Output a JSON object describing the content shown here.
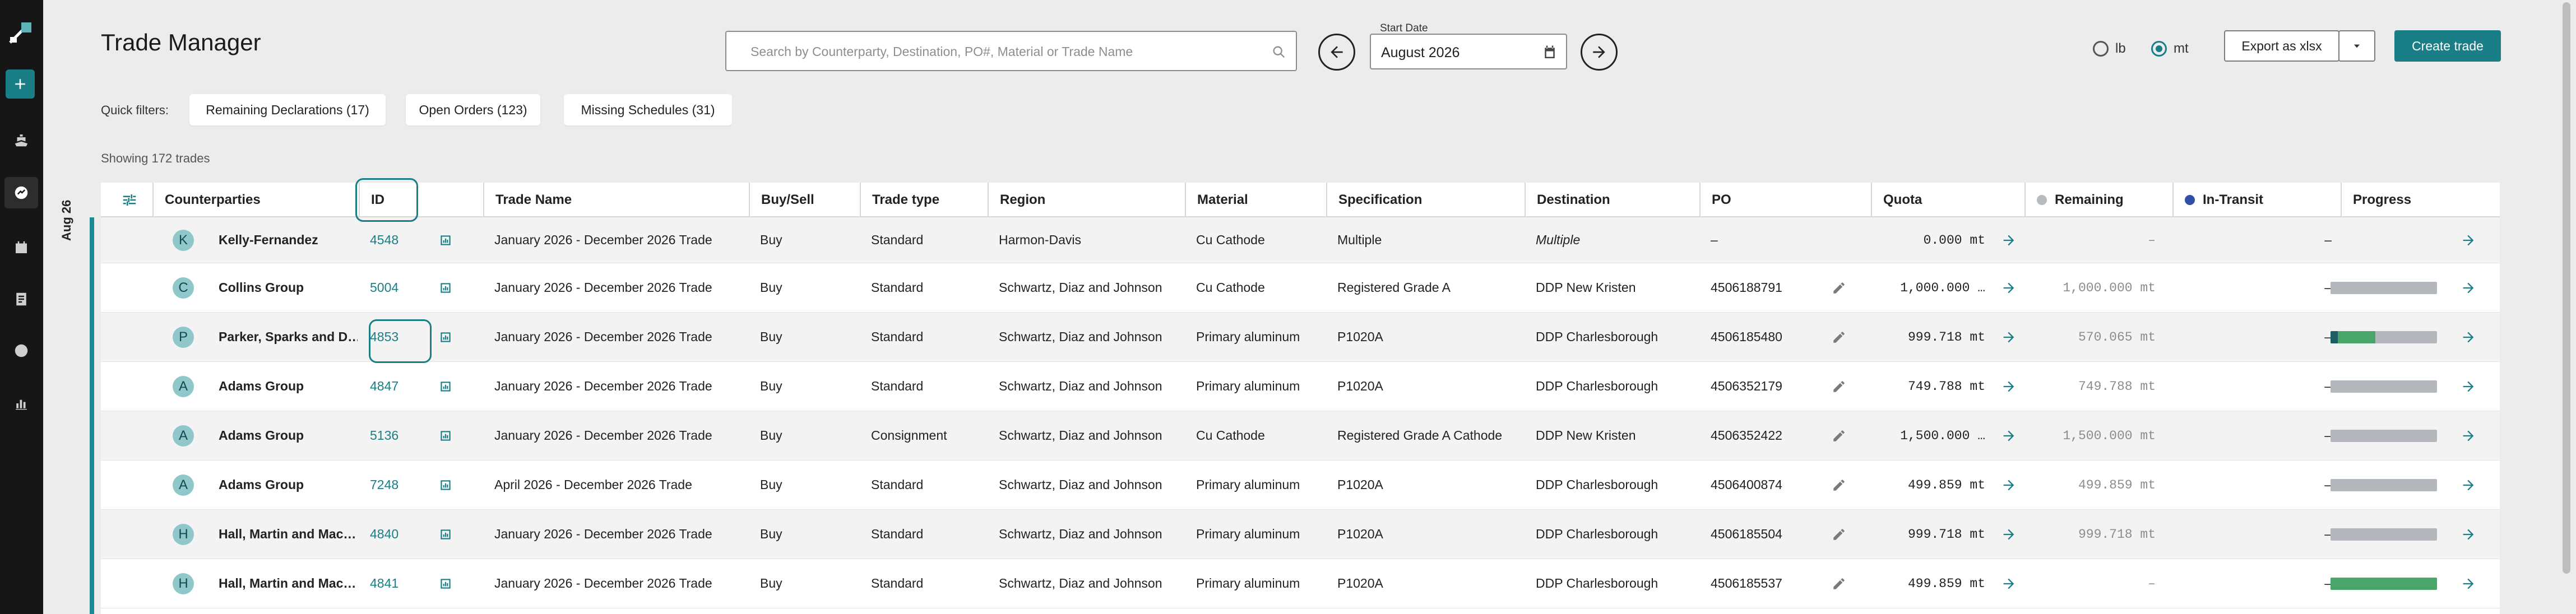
{
  "app": {
    "title": "Trade Manager",
    "search_placeholder": "Search by Counterparty, Destination, PO#, Material or Trade Name",
    "start_date_label": "Start Date",
    "start_date_value": "August 2026",
    "unit_lb": "lb",
    "unit_mt": "mt",
    "selected_unit": "mt",
    "export_label": "Export as xlsx",
    "create_label": "Create trade",
    "accent_color": "#197e86"
  },
  "filters": {
    "label": "Quick filters:",
    "chips": [
      "Remaining Declarations (17)",
      "Open Orders (123)",
      "Missing Schedules (31)"
    ]
  },
  "showing_text": "Showing 172 trades",
  "month_label": "Aug 26",
  "table": {
    "headers": {
      "counterparties": "Counterparties",
      "id": "ID",
      "trade_name": "Trade Name",
      "buy_sell": "Buy/Sell",
      "trade_type": "Trade type",
      "region": "Region",
      "material": "Material",
      "specification": "Specification",
      "destination": "Destination",
      "po": "PO",
      "quota": "Quota",
      "remaining": "Remaining",
      "in_transit": "In-Transit",
      "progress": "Progress"
    },
    "rows": [
      {
        "initial": "K",
        "counterparty": "Kelly-Fernandez",
        "id": "4548",
        "trade_name": "January 2026 - December 2026 Trade",
        "buy_sell": "Buy",
        "trade_type": "Standard",
        "region": "Harmon-Davis",
        "material": "Cu Cathode",
        "specification": "Multiple",
        "destination": "Multiple",
        "po": "–",
        "quota": "0.000 mt",
        "remaining": "–",
        "in_transit": "–",
        "progress": null
      },
      {
        "initial": "C",
        "counterparty": "Collins Group",
        "id": "5004",
        "trade_name": "January 2026 - December 2026 Trade",
        "buy_sell": "Buy",
        "trade_type": "Standard",
        "region": "Schwartz, Diaz and Johnson",
        "material": "Cu Cathode",
        "specification": "Registered Grade A",
        "destination": "DDP New Kristen",
        "po": "4506188791",
        "quota": "1,000.000 …",
        "remaining": "1,000.000 mt",
        "in_transit": "–",
        "progress": {
          "dark": 0,
          "green": 0
        }
      },
      {
        "initial": "P",
        "counterparty": "Parker, Sparks and D…",
        "id": "4853",
        "trade_name": "January 2026 - December 2026 Trade",
        "buy_sell": "Buy",
        "trade_type": "Standard",
        "region": "Schwartz, Diaz and Johnson",
        "material": "Primary aluminum",
        "specification": "P1020A",
        "destination": "DDP Charlesborough",
        "po": "4506185480",
        "quota": "999.718 mt",
        "remaining": "570.065 mt",
        "in_transit": "–",
        "progress": {
          "dark": 0.07,
          "green": 0.35
        }
      },
      {
        "initial": "A",
        "counterparty": "Adams Group",
        "id": "4847",
        "trade_name": "January 2026 - December 2026 Trade",
        "buy_sell": "Buy",
        "trade_type": "Standard",
        "region": "Schwartz, Diaz and Johnson",
        "material": "Primary aluminum",
        "specification": "P1020A",
        "destination": "DDP Charlesborough",
        "po": "4506352179",
        "quota": "749.788 mt",
        "remaining": "749.788 mt",
        "in_transit": "–",
        "progress": {
          "dark": 0,
          "green": 0
        }
      },
      {
        "initial": "A",
        "counterparty": "Adams Group",
        "id": "5136",
        "trade_name": "January 2026 - December 2026 Trade",
        "buy_sell": "Buy",
        "trade_type": "Consignment",
        "region": "Schwartz, Diaz and Johnson",
        "material": "Cu Cathode",
        "specification": "Registered Grade A Cathode",
        "destination": "DDP New Kristen",
        "po": "4506352422",
        "quota": "1,500.000 …",
        "remaining": "1,500.000 mt",
        "in_transit": "–",
        "progress": {
          "dark": 0,
          "green": 0
        }
      },
      {
        "initial": "A",
        "counterparty": "Adams Group",
        "id": "7248",
        "trade_name": "April 2026 - December 2026 Trade",
        "buy_sell": "Buy",
        "trade_type": "Standard",
        "region": "Schwartz, Diaz and Johnson",
        "material": "Primary aluminum",
        "specification": "P1020A",
        "destination": "DDP Charlesborough",
        "po": "4506400874",
        "quota": "499.859 mt",
        "remaining": "499.859 mt",
        "in_transit": "–",
        "progress": {
          "dark": 0,
          "green": 0
        }
      },
      {
        "initial": "H",
        "counterparty": "Hall, Martin and Mac…",
        "id": "4840",
        "trade_name": "January 2026 - December 2026 Trade",
        "buy_sell": "Buy",
        "trade_type": "Standard",
        "region": "Schwartz, Diaz and Johnson",
        "material": "Primary aluminum",
        "specification": "P1020A",
        "destination": "DDP Charlesborough",
        "po": "4506185504",
        "quota": "999.718 mt",
        "remaining": "999.718 mt",
        "in_transit": "–",
        "progress": {
          "dark": 0,
          "green": 0
        }
      },
      {
        "initial": "H",
        "counterparty": "Hall, Martin and Mac…",
        "id": "4841",
        "trade_name": "January 2026 - December 2026 Trade",
        "buy_sell": "Buy",
        "trade_type": "Standard",
        "region": "Schwartz, Diaz and Johnson",
        "material": "Primary aluminum",
        "specification": "P1020A",
        "destination": "DDP Charlesborough",
        "po": "4506185537",
        "quota": "499.859 mt",
        "remaining": "–",
        "in_transit": "–",
        "progress": {
          "dark": 0,
          "green": 1
        }
      }
    ]
  },
  "icons": {
    "logo": "app-logo-icon",
    "plus": "plus-icon",
    "ship": "ship-icon",
    "trades": "trades-icon",
    "calendar": "calendar-nav-icon",
    "document": "document-icon",
    "globe": "globe-icon",
    "chart": "chart-icon"
  }
}
